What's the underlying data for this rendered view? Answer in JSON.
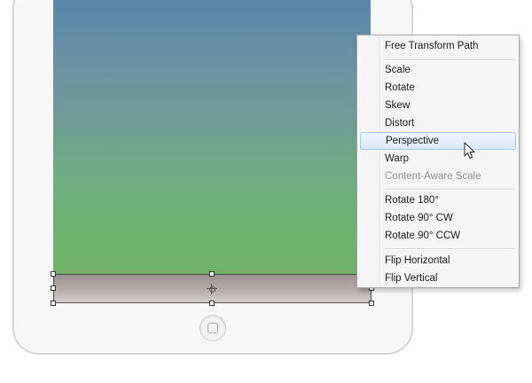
{
  "context_menu": {
    "items": [
      {
        "label": "Free Transform Path",
        "enabled": true,
        "highlighted": false
      },
      {
        "label": "Scale",
        "enabled": true,
        "highlighted": false
      },
      {
        "label": "Rotate",
        "enabled": true,
        "highlighted": false
      },
      {
        "label": "Skew",
        "enabled": true,
        "highlighted": false
      },
      {
        "label": "Distort",
        "enabled": true,
        "highlighted": false
      },
      {
        "label": "Perspective",
        "enabled": true,
        "highlighted": true
      },
      {
        "label": "Warp",
        "enabled": true,
        "highlighted": false
      },
      {
        "label": "Content-Aware Scale",
        "enabled": false,
        "highlighted": false
      },
      {
        "label": "Rotate 180°",
        "enabled": true,
        "highlighted": false
      },
      {
        "label": "Rotate 90° CW",
        "enabled": true,
        "highlighted": false
      },
      {
        "label": "Rotate 90° CCW",
        "enabled": true,
        "highlighted": false
      },
      {
        "label": "Flip Horizontal",
        "enabled": true,
        "highlighted": false
      },
      {
        "label": "Flip Vertical",
        "enabled": true,
        "highlighted": false
      }
    ]
  },
  "colors": {
    "menu_background": "#f5f5f5",
    "highlight_border": "#a8c6ec",
    "disabled_text": "#8f8f8f",
    "screen_top": "#5a86a8",
    "screen_bottom": "#72b168"
  },
  "icons": {
    "cursor": "arrow-pointer-icon",
    "reference_point": "center-reference-point-icon",
    "home_button": "home-button-icon"
  }
}
